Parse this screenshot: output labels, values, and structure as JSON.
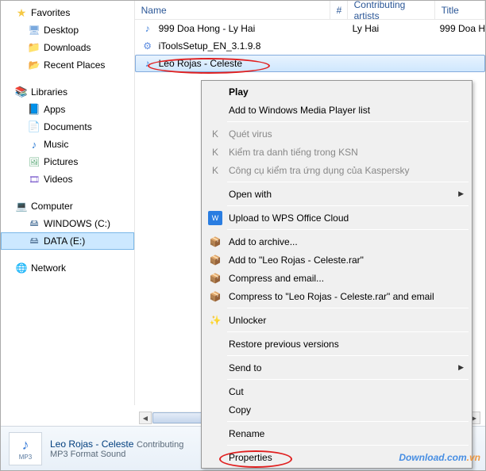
{
  "sidebar": {
    "favorites": {
      "label": "Favorites",
      "items": [
        "Desktop",
        "Downloads",
        "Recent Places"
      ]
    },
    "libraries": {
      "label": "Libraries",
      "items": [
        "Apps",
        "Documents",
        "Music",
        "Pictures",
        "Videos"
      ]
    },
    "computer": {
      "label": "Computer",
      "drives": [
        "WINDOWS (C:)",
        "DATA (E:)"
      ]
    },
    "network": {
      "label": "Network"
    }
  },
  "columns": {
    "name": "Name",
    "num": "#",
    "artist": "Contributing artists",
    "title": "Title"
  },
  "files": [
    {
      "icon": "mp3",
      "name": "999 Doa Hong - Ly Hai",
      "num": "",
      "artist": "Ly Hai",
      "title": "999 Doa H"
    },
    {
      "icon": "exe",
      "name": "iToolsSetup_EN_3.1.9.8",
      "num": "",
      "artist": "",
      "title": ""
    },
    {
      "icon": "mp3",
      "name": "Leo Rojas - Celeste",
      "num": "",
      "artist": "",
      "title": "",
      "selected": true
    }
  ],
  "context_menu": {
    "play": "Play",
    "add_wmp": "Add to Windows Media Player list",
    "av1": "Quét virus",
    "av2": "Kiểm tra danh tiếng trong KSN",
    "av3": "Công cụ kiểm tra ứng dụng của Kaspersky",
    "open_with": "Open with",
    "wps": "Upload to WPS Office Cloud",
    "archive1": "Add to archive...",
    "archive2": "Add to \"Leo Rojas - Celeste.rar\"",
    "archive3": "Compress and email...",
    "archive4": "Compress to \"Leo Rojas - Celeste.rar\" and email",
    "unlocker": "Unlocker",
    "restore": "Restore previous versions",
    "send_to": "Send to",
    "cut": "Cut",
    "copy": "Copy",
    "rename": "Rename",
    "properties": "Properties"
  },
  "details": {
    "title": "Leo Rojas - Celeste",
    "meta_label": "Contributing",
    "subtitle": "MP3 Format Sound",
    "ext": "MP3"
  },
  "watermark": {
    "a": "Download",
    "b": ".com",
    "c": ".vn"
  }
}
